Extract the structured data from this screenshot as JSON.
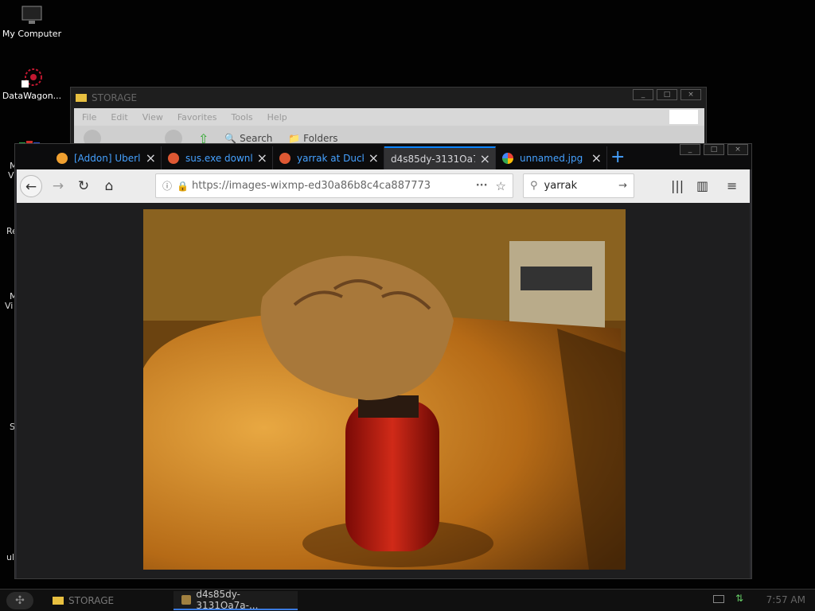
{
  "desktop": {
    "icons": [
      {
        "label": "My Computer"
      },
      {
        "label": "DataWagon..."
      }
    ],
    "partial_labels": [
      "M",
      "Vi",
      "Re",
      "M",
      "Vi",
      "S",
      "ul"
    ]
  },
  "storage_window": {
    "title": "STORAGE",
    "menu": [
      "File",
      "Edit",
      "View",
      "Favorites",
      "Tools",
      "Help"
    ],
    "toolbar": {
      "search_label": "Search",
      "folders_label": "Folders"
    }
  },
  "browser": {
    "tabs": [
      {
        "title": "[Addon] Uberl",
        "favicon_color": "#f0a030"
      },
      {
        "title": "sus.exe downl",
        "favicon_color": "#de5833"
      },
      {
        "title": "yarrak at Duck",
        "favicon_color": "#de5833"
      },
      {
        "title": "d4s85dy-3131Oa7",
        "favicon_color": "",
        "active": true
      },
      {
        "title": "unnamed.jpg (",
        "favicon_color": "#4285f4"
      }
    ],
    "new_tab_label": "+",
    "url": "https://images-wixmp-ed30a86b8c4ca887773",
    "search_value": "yarrak",
    "accent_color": "#0a84ff"
  },
  "taskbar": {
    "tasks": [
      {
        "label": "STORAGE"
      },
      {
        "label": "d4s85dy-3131Oa7a-..."
      }
    ],
    "clock": "7:57 AM"
  }
}
